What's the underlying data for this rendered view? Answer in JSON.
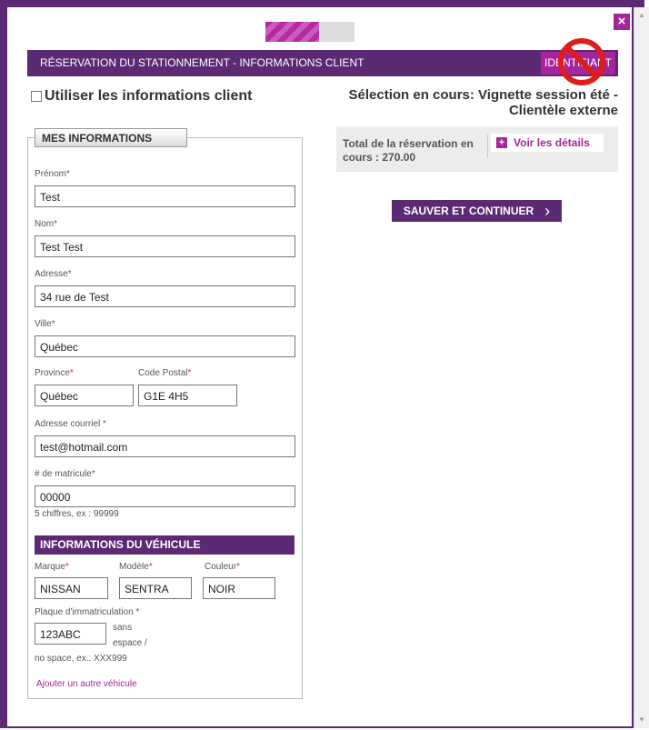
{
  "window": {
    "close_label": "×",
    "scroll_up": "▲",
    "scroll_down": "▼"
  },
  "progress": {
    "value_fraction": 0.6
  },
  "header": {
    "title": "RÉSERVATION DU STATIONNEMENT - INFORMATIONS CLIENT",
    "identifiant_button": "IDENTIFIANT"
  },
  "use_client": {
    "label": "Utiliser les informations client",
    "checked": false
  },
  "selection": {
    "line1": "Sélection en cours: Vignette session été -",
    "line2": "Clientèle externe"
  },
  "total": {
    "text": "Total de la réservation en cours : 270.00",
    "details_icon": "+",
    "details_label": "Voir les détails"
  },
  "save_button": {
    "label": "SAUVER ET CONTINUER",
    "chevron": "›"
  },
  "mes_informations": {
    "legend": "MES INFORMATIONS",
    "prenom": {
      "label": "Prénom",
      "value": "Test"
    },
    "nom": {
      "label": "Nom",
      "value": "Test Test"
    },
    "adresse": {
      "label": "Adresse",
      "value": "34 rue de Test"
    },
    "ville": {
      "label": "Ville",
      "value": "Québec"
    },
    "province": {
      "label": "Province",
      "value": "Québec"
    },
    "code_postal": {
      "label": "Code Postal",
      "value": "G1E 4H5"
    },
    "courriel": {
      "label": "Adresse courriel ",
      "value": "test@hotmail.com"
    },
    "matricule": {
      "label": "# de matricule",
      "value": "00000",
      "hint": "5 chiffres, ex : 99999"
    }
  },
  "vehicule": {
    "heading": "INFORMATIONS DU VÉHICULE",
    "marque": {
      "label": "Marque",
      "value": "NISSAN"
    },
    "modele": {
      "label": "Modèle",
      "value": "SENTRA"
    },
    "couleur": {
      "label": "Couleur",
      "value": "NOIR"
    },
    "plaque": {
      "label": "Plaque d'immatriculation ",
      "value": "123ABC",
      "hint_a": "sans",
      "hint_b": "espace /",
      "hint_c": "no space, ex.: XXX999"
    },
    "add_link": "Ajouter un autre véhicule"
  },
  "required_mark": "*",
  "colors": {
    "brand_purple": "#5b2a73",
    "accent_magenta": "#a5259b"
  },
  "icons": {
    "close": "close-icon",
    "no_sign": "no-entry-icon",
    "plus": "plus-icon",
    "chevron": "chevron-right-icon"
  }
}
